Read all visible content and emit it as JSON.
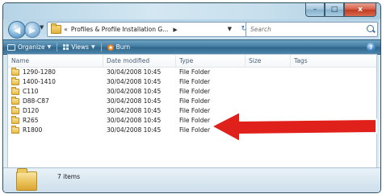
{
  "window": {
    "caption_minimize": "–",
    "caption_maximize": "□",
    "caption_close": "x"
  },
  "navigation": {
    "back_glyph": "◀",
    "forward_glyph": "▶",
    "history_glyph": "▼",
    "address_separator": "«",
    "address_path": "Profiles & Profile Installation G...",
    "address_arrow": "▶",
    "address_dropdown": "▼",
    "refresh_glyph": "↻",
    "search_placeholder": "Search"
  },
  "toolbar": {
    "organize_label": "Organize",
    "views_label": "Views",
    "burn_label": "Burn",
    "caret": "▼",
    "help_label": "?"
  },
  "columns": {
    "name": "Name",
    "date_modified": "Date modified",
    "type": "Type",
    "size": "Size",
    "tags": "Tags"
  },
  "files": [
    {
      "name": "1290-1280",
      "date": "30/04/2008 10:45",
      "type": "File Folder"
    },
    {
      "name": "1400-1410",
      "date": "30/04/2008 10:45",
      "type": "File Folder"
    },
    {
      "name": "C110",
      "date": "30/04/2008 10:45",
      "type": "File Folder"
    },
    {
      "name": "D88-C87",
      "date": "30/04/2008 10:45",
      "type": "File Folder"
    },
    {
      "name": "D120",
      "date": "30/04/2008 10:45",
      "type": "File Folder"
    },
    {
      "name": "R265",
      "date": "30/04/2008 10:45",
      "type": "File Folder"
    },
    {
      "name": "R1800",
      "date": "30/04/2008 10:45",
      "type": "File Folder"
    }
  ],
  "status": {
    "item_count": "7 items"
  },
  "annotation": {
    "arrow_color": "#e0201a",
    "arrow_outline": "#ffffff",
    "points_to_row": "D120"
  }
}
